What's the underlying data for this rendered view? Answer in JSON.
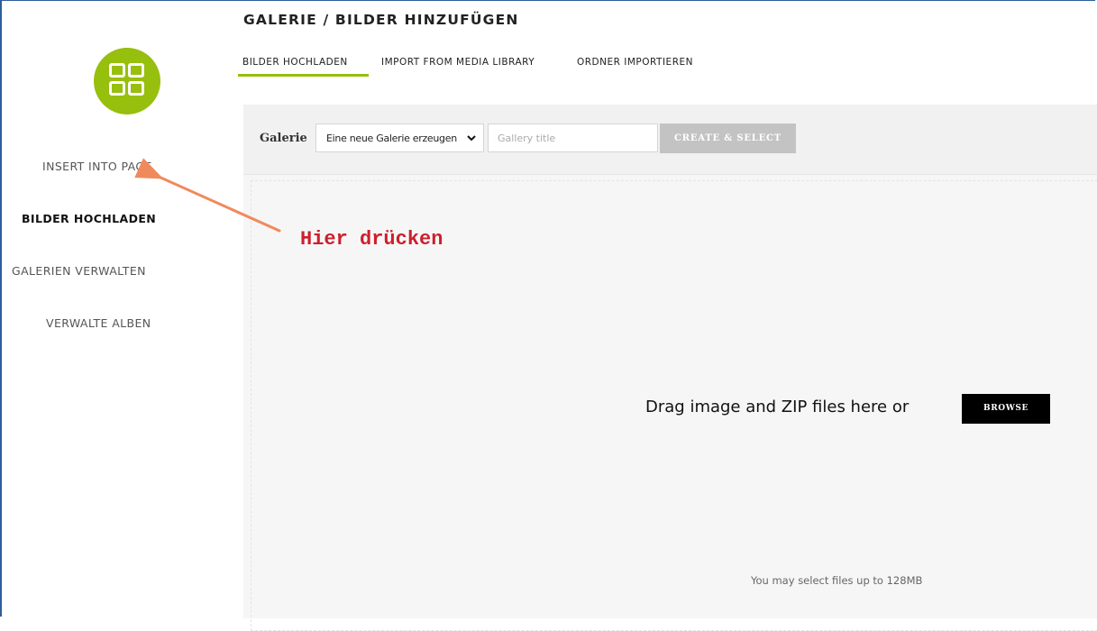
{
  "header": {
    "title": "GALERIE / BILDER HINZUFÜGEN",
    "tabs": [
      {
        "label": "BILDER HOCHLADEN",
        "active": true
      },
      {
        "label": "IMPORT FROM MEDIA LIBRARY",
        "active": false
      },
      {
        "label": "ORDNER IMPORTIEREN",
        "active": false
      }
    ]
  },
  "sidebar": {
    "logo_icon": "grid-icon",
    "items": [
      {
        "label": "INSERT INTO PAGE",
        "active": false
      },
      {
        "label": "BILDER HOCHLADEN",
        "active": true
      },
      {
        "label": "GALERIEN VERWALTEN",
        "active": false
      },
      {
        "label": "VERWALTE ALBEN",
        "active": false
      }
    ]
  },
  "toolbar": {
    "gallery_label": "Galerie",
    "gallery_select_value": "Eine neue Galerie erzeugen",
    "gallery_title_placeholder": "Gallery title",
    "create_button_label": "CREATE & SELECT"
  },
  "dropzone": {
    "prompt_text": "Drag image and ZIP files here or",
    "browse_button_label": "BROWSE",
    "size_limit_text": "You may select files up to 128MB"
  },
  "annotation": {
    "text": "Hier drücken",
    "color": "#cc1f2d",
    "arrow_color": "#f08a5d"
  },
  "colors": {
    "accent": "#97bf0d",
    "window_border": "#2f5d9b",
    "disabled_button": "#c3c3c3"
  }
}
